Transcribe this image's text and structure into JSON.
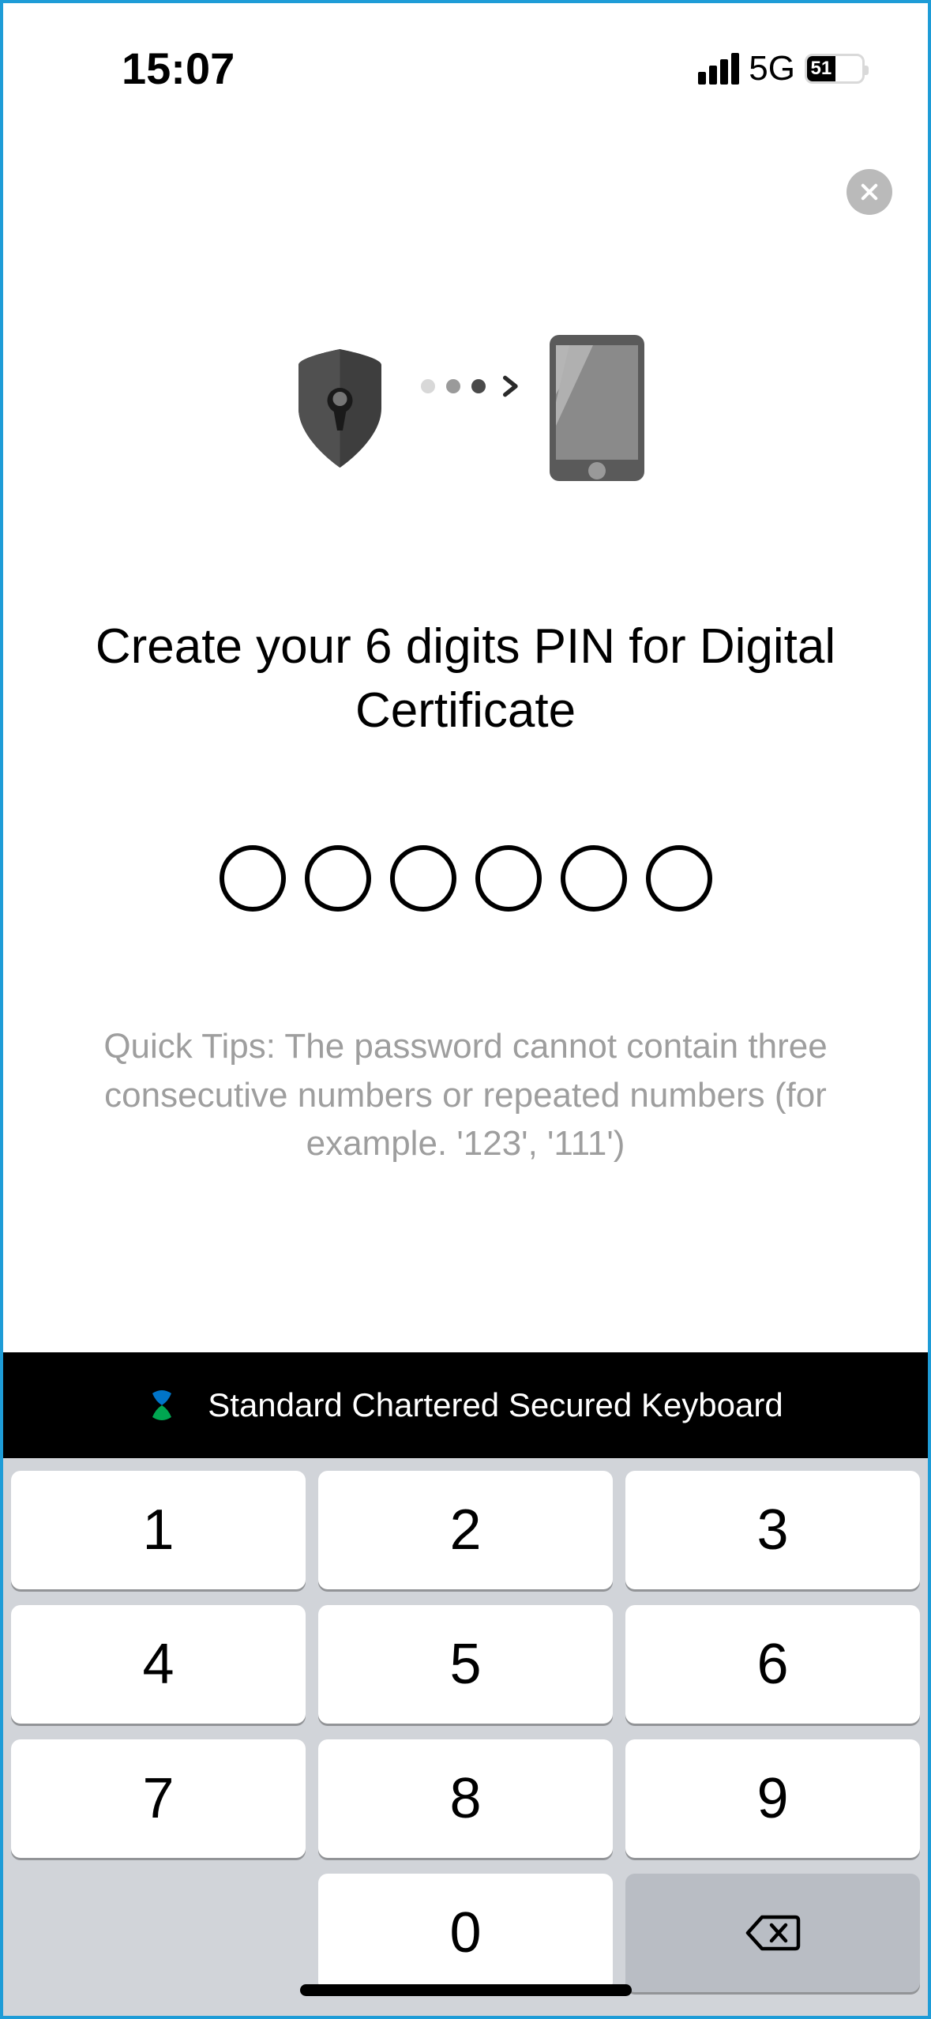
{
  "status": {
    "time": "15:07",
    "network": "5G",
    "battery": "51"
  },
  "heading": "Create your 6 digits PIN for Digital Certificate",
  "pin_length": 6,
  "tips": "Quick Tips: The password cannot contain three consecutive numbers or repeated numbers (for example. '123', '111')",
  "keyboard": {
    "header": "Standard Chartered Secured Keyboard",
    "keys": [
      "1",
      "2",
      "3",
      "4",
      "5",
      "6",
      "7",
      "8",
      "9",
      "",
      "0",
      "backspace"
    ]
  },
  "icons": {
    "close": "close-icon",
    "shield": "shield-lock-icon",
    "phone": "phone-icon",
    "chevron": "chevron-right-icon",
    "logo": "standard-chartered-logo",
    "backspace": "backspace-icon"
  }
}
